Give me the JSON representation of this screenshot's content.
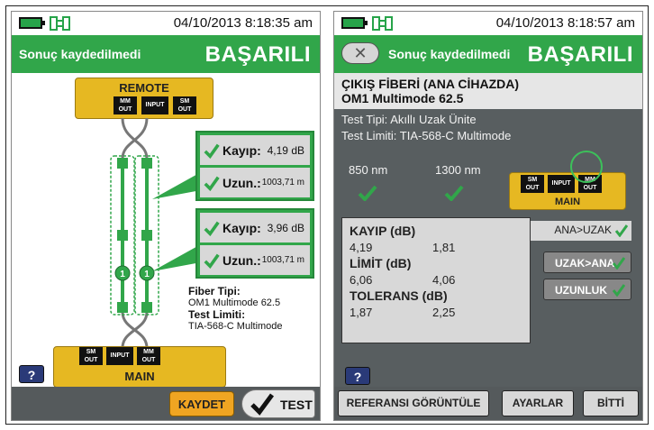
{
  "left": {
    "status": {
      "time": "04/10/2013 8:18:35 am"
    },
    "header": {
      "save_status": "Sonuç kaydedilmedi",
      "result": "BAŞARILI"
    },
    "remote": {
      "label": "REMOTE",
      "ports": [
        "MM\nOUT",
        "INPUT",
        "SM\nOUT"
      ]
    },
    "main": {
      "label": "MAIN",
      "ports": [
        "SM\nOUT",
        "INPUT",
        "MM\nOUT"
      ]
    },
    "results": [
      {
        "loss_label": "Kayıp:",
        "loss": "4,19 dB",
        "length_label": "Uzun.:",
        "length": "1003,71 m"
      },
      {
        "loss_label": "Kayıp:",
        "loss": "3,96 dB",
        "length_label": "Uzun.:",
        "length": "1003,71 m"
      }
    ],
    "fiber": {
      "type_label": "Fiber Tipi:",
      "type": "OM1 Multimode 62.5",
      "limit_label": "Test Limiti:",
      "limit": "TIA-568-C Multimode"
    },
    "markers": [
      "1",
      "1"
    ],
    "help": "?",
    "buttons": {
      "save": "KAYDET",
      "test": "TEST"
    }
  },
  "right": {
    "status": {
      "time": "04/10/2013 8:18:57 am"
    },
    "header": {
      "save_status": "Sonuç kaydedilmedi",
      "result": "BAŞARILI"
    },
    "title1": "ÇIKIŞ FİBERİ (ANA CİHAZDA)",
    "title2": "OM1 Multimode 62.5",
    "test_type": "Test Tipi: Akıllı Uzak Ünite",
    "test_limit": "Test Limiti: TIA-568-C Multimode",
    "wl1": "850 nm",
    "wl2": "1300 nm",
    "device": {
      "label": "MAIN",
      "ports": [
        "SM\nOUT",
        "INPUT",
        "MM\nOUT"
      ]
    },
    "table": {
      "loss_header": "KAYIP (dB)",
      "loss": [
        "4,19",
        "1,81"
      ],
      "limit_header": "LİMİT (dB)",
      "limit": [
        "6,06",
        "4,06"
      ],
      "tol_header": "TOLERANS (dB)",
      "tol": [
        "1,87",
        "2,25"
      ]
    },
    "direction": "ANA>UZAK",
    "side_buttons": {
      "reverse": "UZAK>ANA",
      "length": "UZUNLUK"
    },
    "help": "?",
    "buttons": {
      "reference": "REFERANSI GÖRÜNTÜLE",
      "settings": "AYARLAR",
      "done": "BİTTİ"
    }
  }
}
